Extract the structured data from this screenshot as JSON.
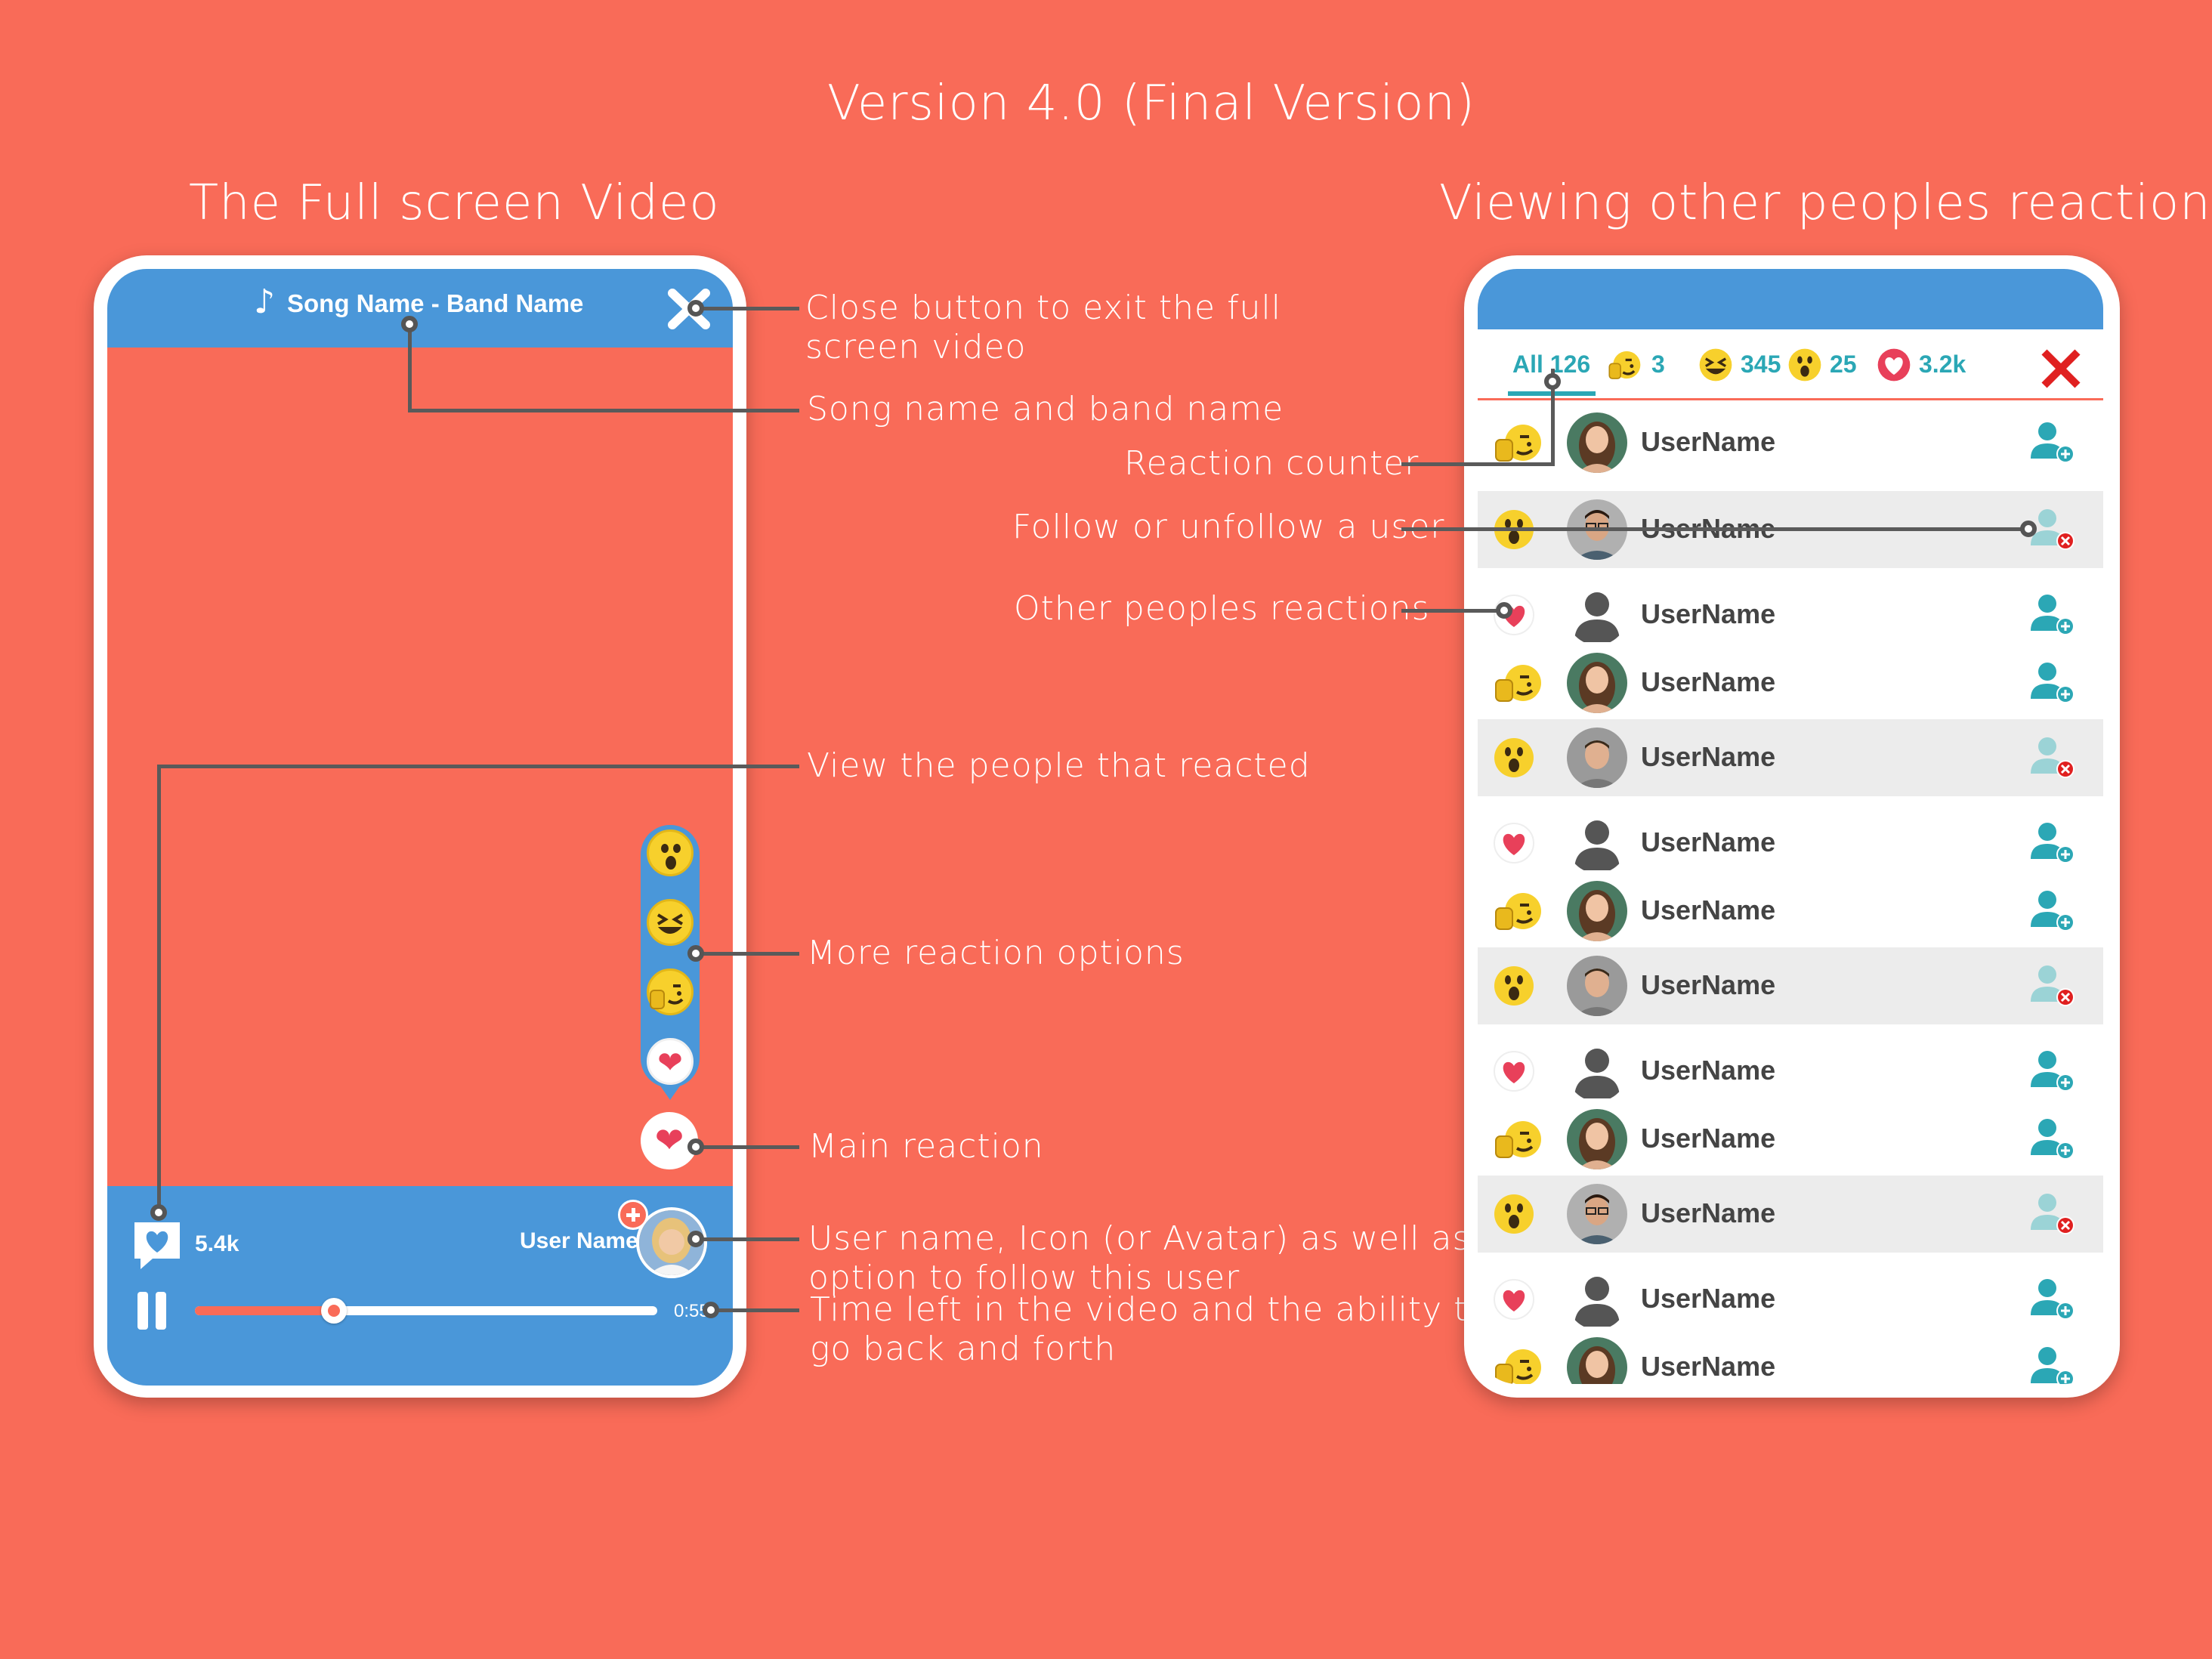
{
  "page": {
    "main_title": "Version 4.0 (Final Version)",
    "left_title": "The Full screen Video",
    "right_title": "Viewing other peoples reactions"
  },
  "video": {
    "song_label": "Song Name - Band Name",
    "reaction_count": "5.4k",
    "user_name": "User Name",
    "time_left": "0:55",
    "progress": 0.3
  },
  "annotations": {
    "close": [
      "Close button to exit the full",
      "screen video"
    ],
    "song": "Song name and band name",
    "view_people": "View the people that reacted",
    "more_reactions": "More reaction options",
    "main_reaction": "Main reaction",
    "user": [
      "User name, Icon (or Avatar) as well as the",
      "option to follow this user"
    ],
    "time": [
      "Time left in the video and the ability to",
      "go back and forth"
    ],
    "reaction_counter": "Reaction counter",
    "follow": "Follow or unfollow a user",
    "other_reactions": "Other peoples reactions"
  },
  "reactions_panel": {
    "tabs": [
      {
        "label": "All 126",
        "icon": "none"
      },
      {
        "label": "3",
        "icon": "thumbs-wink-emoji"
      },
      {
        "label": "345",
        "icon": "laughing-emoji"
      },
      {
        "label": "25",
        "icon": "surprised-emoji"
      },
      {
        "label": "3.2k",
        "icon": "heart-icon"
      }
    ],
    "rows": [
      {
        "reaction": "thumbs-wink",
        "avatar": "woman",
        "name": "UserName",
        "following": false
      },
      {
        "reaction": "surprised",
        "avatar": "man-glasses",
        "name": "UserName",
        "following": true
      },
      {
        "reaction": "heart",
        "avatar": "placeholder",
        "name": "UserName",
        "following": false
      },
      {
        "reaction": "thumbs-wink",
        "avatar": "woman",
        "name": "UserName",
        "following": false
      },
      {
        "reaction": "surprised",
        "avatar": "man",
        "name": "UserName",
        "following": true
      },
      {
        "reaction": "heart",
        "avatar": "placeholder",
        "name": "UserName",
        "following": false
      },
      {
        "reaction": "thumbs-wink",
        "avatar": "woman",
        "name": "UserName",
        "following": false
      },
      {
        "reaction": "surprised",
        "avatar": "man",
        "name": "UserName",
        "following": true
      },
      {
        "reaction": "heart",
        "avatar": "placeholder",
        "name": "UserName",
        "following": false
      },
      {
        "reaction": "thumbs-wink",
        "avatar": "woman",
        "name": "UserName",
        "following": false
      },
      {
        "reaction": "surprised",
        "avatar": "man-glasses",
        "name": "UserName",
        "following": true
      },
      {
        "reaction": "heart",
        "avatar": "placeholder",
        "name": "UserName",
        "following": false
      },
      {
        "reaction": "thumbs-wink",
        "avatar": "woman",
        "name": "UserName",
        "following": false
      }
    ]
  },
  "colors": {
    "background": "#F96B58",
    "blue": "#4A97D9",
    "teal": "#2BA7B5",
    "heart": "#E8405A",
    "emoji": "#F7D02C"
  }
}
